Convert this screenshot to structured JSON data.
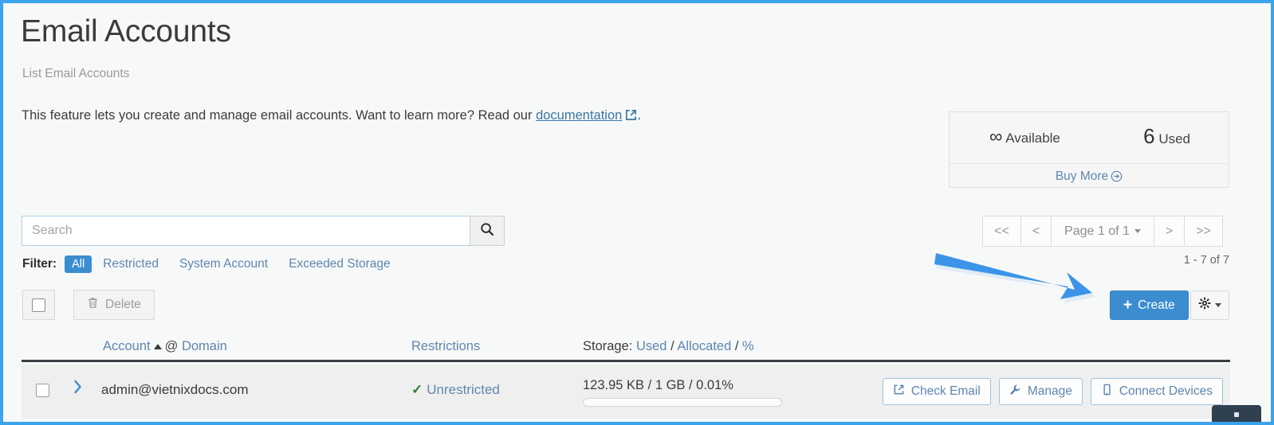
{
  "header": {
    "title": "Email Accounts",
    "subtitle": "List Email Accounts",
    "intro_before": "This feature lets you create and manage email accounts. Want to learn more? Read our ",
    "intro_link": "documentation",
    "intro_after": "."
  },
  "quota": {
    "available_value": "∞",
    "available_label": "Available",
    "used_value": "6",
    "used_label": "Used",
    "buy_more": "Buy More"
  },
  "search": {
    "placeholder": "Search",
    "value": ""
  },
  "filter": {
    "label": "Filter:",
    "active": "All",
    "options": [
      "All",
      "Restricted",
      "System Account",
      "Exceeded Storage"
    ]
  },
  "pagination": {
    "first": "<<",
    "prev": "<",
    "page_label": "Page 1 of 1",
    "next": ">",
    "last": ">>",
    "count": "1 - 7 of 7"
  },
  "actions": {
    "delete_label": "Delete",
    "create_label": "Create",
    "create_color": "#3b8dd0"
  },
  "table": {
    "columns": {
      "account": "Account",
      "account_sep": "@",
      "domain": "Domain",
      "restrictions": "Restrictions",
      "storage_label": "Storage:",
      "storage_used": "Used",
      "storage_allocated": "Allocated",
      "storage_percent": "%"
    },
    "rows": [
      {
        "account": "admin@vietnixdocs.com",
        "restriction": "Unrestricted",
        "restriction_color": "#2f7d32",
        "storage": "123.95 KB / 1 GB / 0.01%",
        "storage_percent": 0.01,
        "buttons": [
          "Check Email",
          "Manage",
          "Connect Devices"
        ]
      }
    ]
  },
  "annotation": {
    "arrow_color": "#3b94e8"
  }
}
